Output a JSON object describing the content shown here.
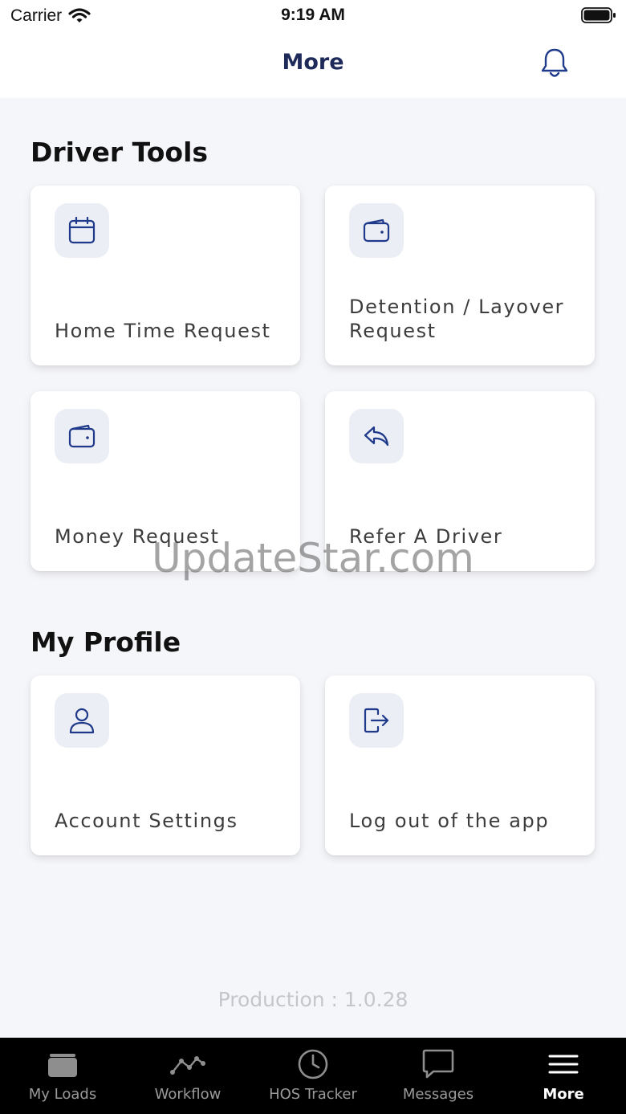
{
  "status_bar": {
    "carrier": "Carrier",
    "time": "9:19 AM"
  },
  "header": {
    "title": "More",
    "notification_icon": "bell-icon"
  },
  "sections": [
    {
      "title": "Driver Tools",
      "cards": [
        {
          "label": "Home Time Request",
          "icon": "calendar-icon"
        },
        {
          "label": "Detention / Layover Request",
          "icon": "wallet-icon"
        },
        {
          "label": "Money Request",
          "icon": "wallet-icon"
        },
        {
          "label": "Refer A Driver",
          "icon": "reply-arrow-icon"
        }
      ]
    },
    {
      "title": "My Profile",
      "cards": [
        {
          "label": "Account Settings",
          "icon": "user-icon"
        },
        {
          "label": "Log out of the app",
          "icon": "logout-icon"
        }
      ]
    }
  ],
  "version": "Production : 1.0.28",
  "watermark": "UpdateStar.com",
  "tabs": [
    {
      "label": "My Loads",
      "icon": "truck-box-icon",
      "active": false
    },
    {
      "label": "Workflow",
      "icon": "workflow-graph-icon",
      "active": false
    },
    {
      "label": "HOS Tracker",
      "icon": "clock-icon",
      "active": false
    },
    {
      "label": "Messages",
      "icon": "message-bubble-icon",
      "active": false
    },
    {
      "label": "More",
      "icon": "menu-icon",
      "active": true
    }
  ],
  "colors": {
    "accent": "#1e2a5a",
    "icon_stroke": "#1f3a8a",
    "icon_bg": "#eceef5",
    "page_bg": "#f5f6fa",
    "tab_bar_bg": "#000000"
  }
}
